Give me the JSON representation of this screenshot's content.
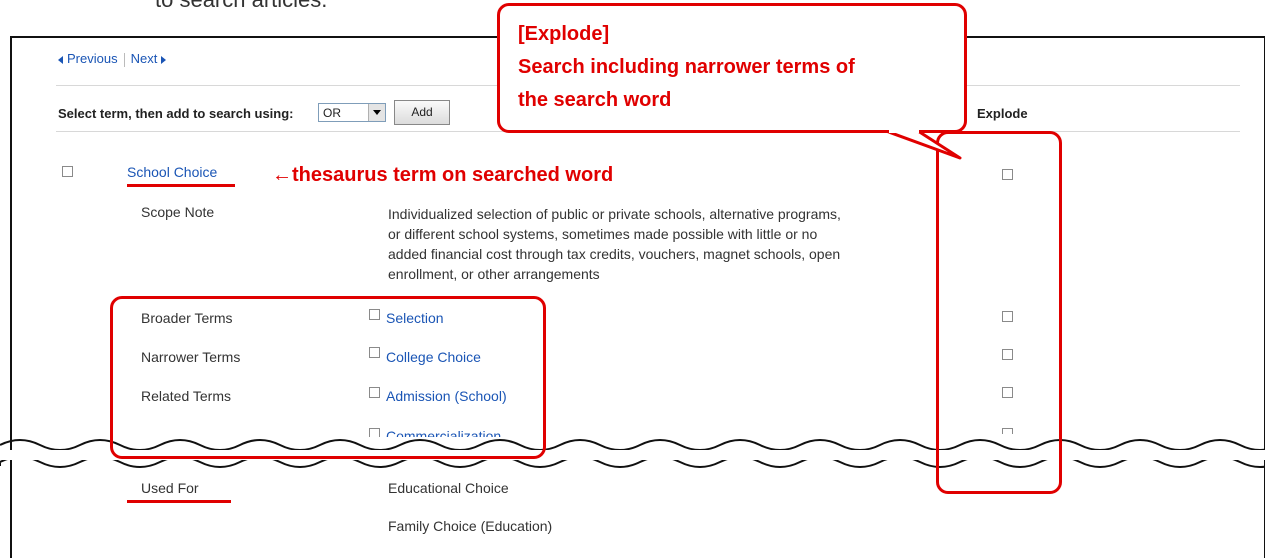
{
  "cut_text": "to search articles.",
  "nav": {
    "previous": "Previous",
    "next": "Next"
  },
  "toolbar": {
    "select_label": "Select term, then add to search using:",
    "operator_value": "OR",
    "add_label": "Add",
    "explode_header": "Explode"
  },
  "term": {
    "name": "School Choice",
    "scope_note_label": "Scope Note",
    "scope_note_lines": [
      "Individualized selection of public or private schools, alternative programs,",
      "or different school systems, sometimes made possible with little or no",
      "added financial cost through tax credits, vouchers, magnet schools, open",
      "enrollment, or other arrangements"
    ],
    "broader_label": "Broader Terms",
    "broader": "Selection",
    "narrower_label": "Narrower Terms",
    "narrower": "College Choice",
    "related_label": "Related Terms",
    "related": "Admission (School)",
    "related_extra": "Commercialization",
    "used_for_label": "Used For",
    "used_for": [
      "Educational Choice",
      "Family Choice (Education)"
    ]
  },
  "annotations": {
    "thesaurus": "←thesaurus term on searched word",
    "callout_title": "[Explode]",
    "callout_line1": "Search including narrower terms of",
    "callout_line2": "the search word"
  },
  "colors": {
    "annotation": "#e00000",
    "link": "#1a55b5"
  }
}
